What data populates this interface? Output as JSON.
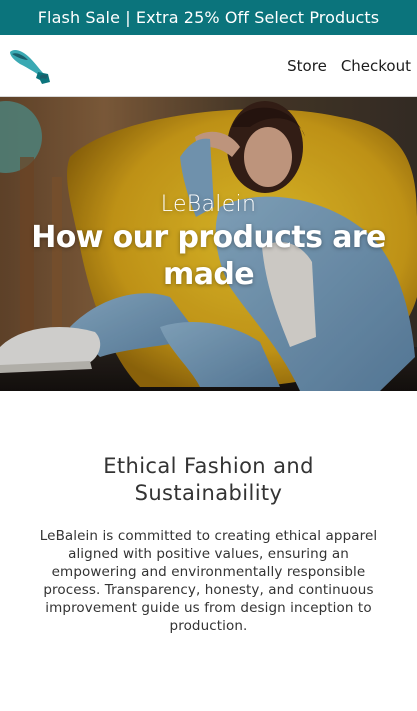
{
  "promo": {
    "text": "Flash Sale | Extra 25% Off Select Products",
    "bg_color": "#0b747c"
  },
  "header": {
    "logo_icon": "whale-tail-logo-icon",
    "nav": [
      {
        "label": "Store"
      },
      {
        "label": "Checkout"
      }
    ]
  },
  "hero": {
    "brand": "LeBalein",
    "title": "How our products are made"
  },
  "section": {
    "title": "Ethical Fashion and Sustainability",
    "body": "LeBalein is committed to creating ethical apparel aligned with positive values, ensuring an empowering and environmentally responsible process. Transparency, honesty, and continuous improvement guide us from design inception to production."
  }
}
